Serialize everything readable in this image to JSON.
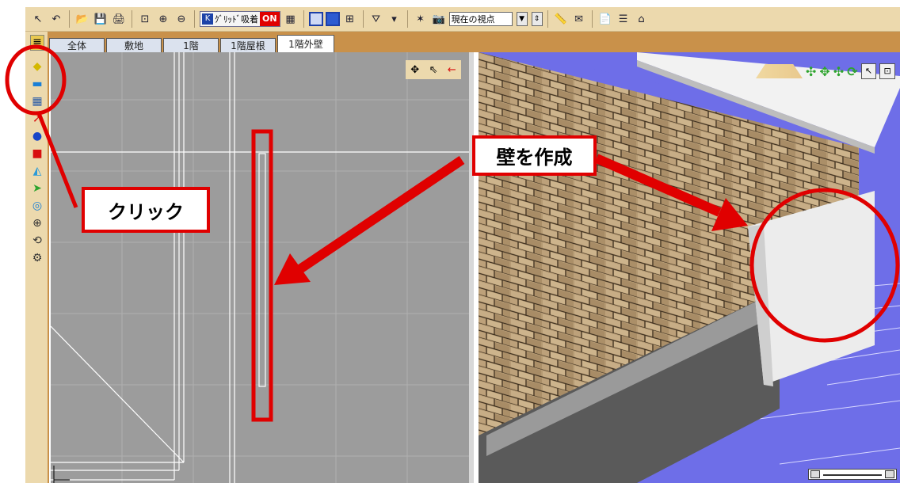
{
  "toolbar": {
    "grid_snap_label": "ｸﾞﾘｯﾄﾞ吸着",
    "grid_snap_state": "ON",
    "viewpoint_select": "現在の視点"
  },
  "tabs": [
    {
      "label": "全体",
      "active": false
    },
    {
      "label": "敷地",
      "active": false
    },
    {
      "label": "1階",
      "active": false
    },
    {
      "label": "1階屋根",
      "active": false
    },
    {
      "label": "1階外壁",
      "active": true
    }
  ],
  "left_tools": [
    "floor-tool-icon",
    "wall-tool-icon",
    "window-tool-icon",
    "pen-tool-icon",
    "sphere-tool-icon",
    "box-tool-icon",
    "shape-tool-icon",
    "arrow-shape-tool-icon",
    "ring-tool-icon",
    "cylinder-tool-icon",
    "rotate-tool-icon",
    "settings-tool-icon"
  ],
  "annotations": {
    "click_label": "クリック",
    "create_wall_label": "壁を作成"
  },
  "colors": {
    "annotation_red": "#e00000",
    "toolbar_bg": "#ecd9ad",
    "tab_strip_bg": "#c9914a",
    "plan_bg": "#9c9c9c",
    "view3d_floor": "#6e6ee8"
  }
}
